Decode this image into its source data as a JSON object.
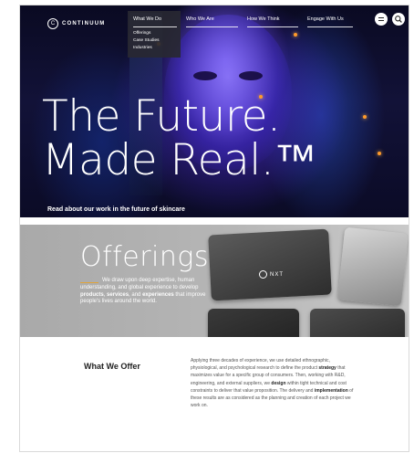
{
  "brand": {
    "logo_mark": "C",
    "logo_text": "CONTINUUM"
  },
  "nav": {
    "items": [
      {
        "label": "What We Do"
      },
      {
        "label": "Who We Are"
      },
      {
        "label": "How We Think"
      },
      {
        "label": "Engage With Us"
      }
    ],
    "dropdown": [
      "Offerings",
      "Case Studies",
      "Industries"
    ],
    "icons": [
      "menu-icon",
      "search-icon"
    ]
  },
  "hero": {
    "title_line1": "The Future.",
    "title_line2": "Made Real.™",
    "caption": "Read about our work in the future of skincare"
  },
  "offerings": {
    "title": "Offerings",
    "device_label": "NXT",
    "text_1": "We draw upon deep expertise, human understanding, and global experience to develop ",
    "bold_1": "products",
    "text_2": ", ",
    "bold_2": "services",
    "text_3": ", and ",
    "bold_3": "experiences",
    "text_4": " that improve people's lives around the world."
  },
  "what_we_offer": {
    "title": "What We Offer",
    "p1": "Applying three decades of experience, we use detailed ethnographic, physiological, and psychological research to define the product ",
    "b1": "strategy",
    "p2": " that maximizes value for a specific group of consumers. Then, working with R&D, engineering, and external suppliers, we ",
    "b2": "design",
    "p3": " within tight technical and cost constraints to deliver that value proposition. The delivery and ",
    "b3": "implementation",
    "p4": " of these results are as considered as the planning and creation of each project we work on."
  },
  "colors": {
    "accent": "#e0a43a",
    "hero_glow": "#5b3fd6",
    "offerings_bg": "#b4b4b4"
  }
}
